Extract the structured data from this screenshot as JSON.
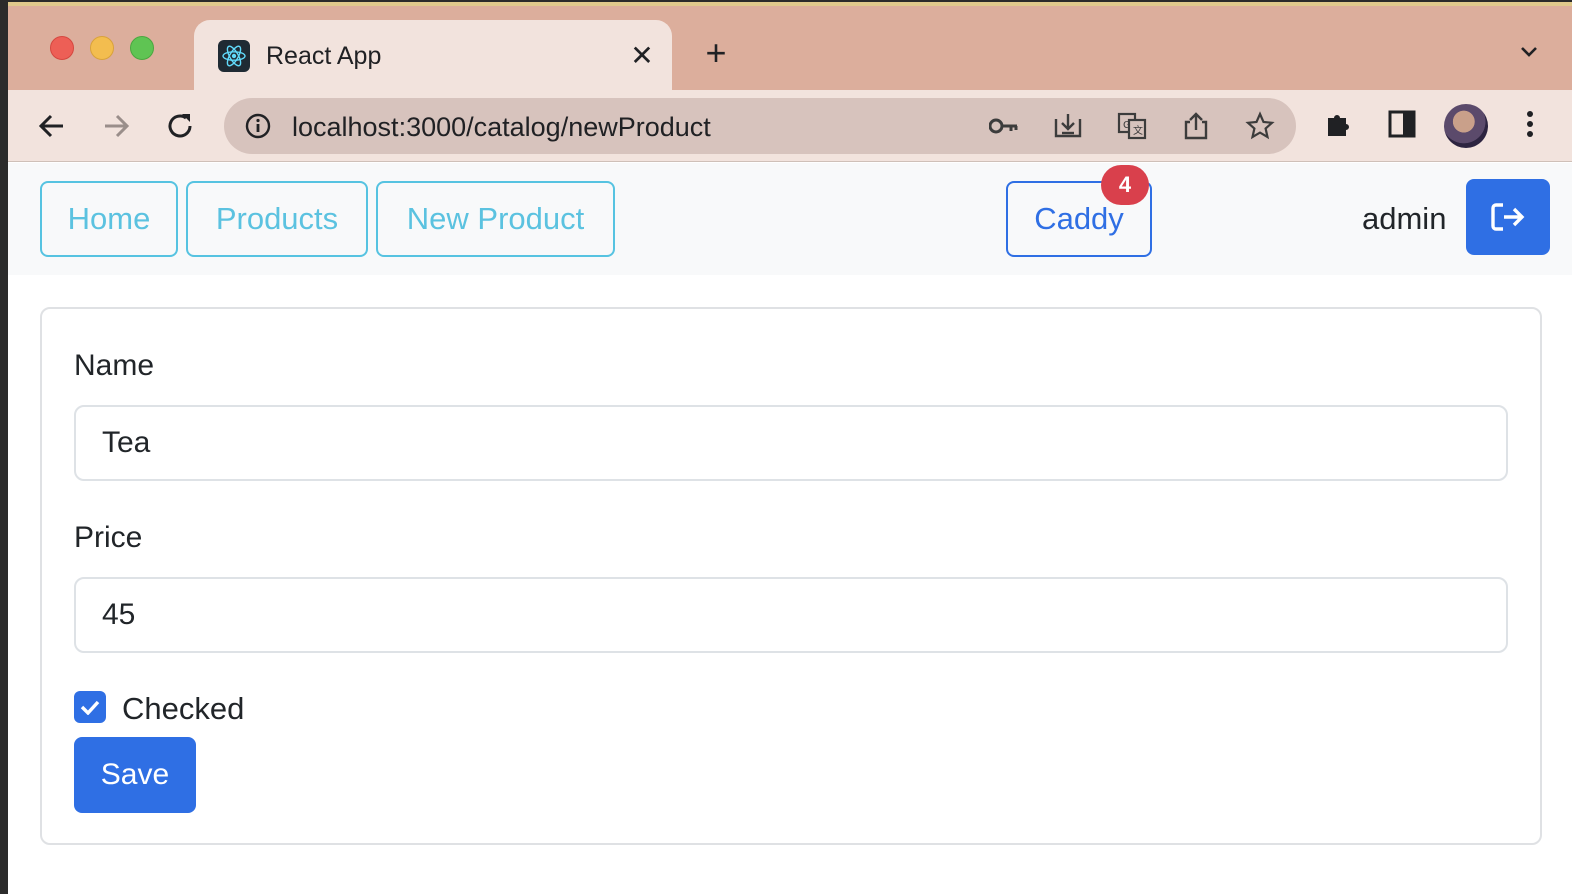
{
  "browser": {
    "tab": {
      "title": "React App",
      "favicon": "react-logo-icon",
      "close": "✕"
    },
    "new_tab": "+",
    "url": "localhost:3000/catalog/newProduct",
    "icons": [
      "info-icon",
      "key-icon",
      "install-icon",
      "translate-icon",
      "share-icon",
      "star-icon",
      "extensions-icon",
      "sidepanel-icon",
      "profile-avatar",
      "more-icon"
    ]
  },
  "navbar": {
    "links": [
      "Home",
      "Products",
      "New Product"
    ],
    "cart": {
      "label": "Caddy",
      "count": "4"
    },
    "user": "admin",
    "logout_icon": "logout-icon"
  },
  "form": {
    "name_label": "Name",
    "name_value": "Tea",
    "price_label": "Price",
    "price_value": "45",
    "checkbox_label": "Checked",
    "checkbox_checked": true,
    "save_label": "Save"
  },
  "colors": {
    "primary": "#2f6fe4",
    "info": "#56c3e1",
    "danger": "#d9404c",
    "tabstrip": "#dcae9c"
  }
}
